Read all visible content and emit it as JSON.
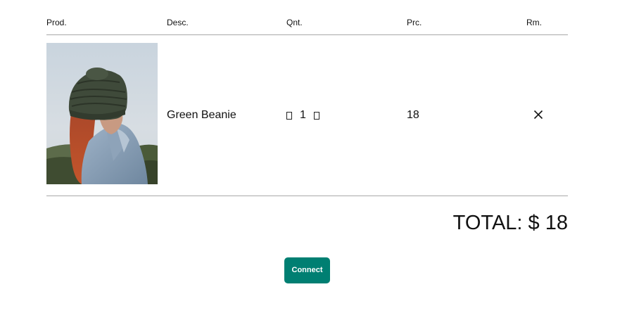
{
  "table": {
    "headers": {
      "product": "Prod.",
      "description": "Desc.",
      "quantity": "Qnt.",
      "price": "Prc.",
      "remove": "Rm."
    },
    "items": [
      {
        "description": "Green Beanie",
        "quantity": "1",
        "price": "18",
        "image_icon": "product-photo-green-beanie",
        "decrement_icon": "decrement-icon",
        "increment_icon": "increment-icon",
        "remove_icon": "close-icon"
      }
    ]
  },
  "summary": {
    "total_label": "TOTAL: $ 18"
  },
  "actions": {
    "connect_label": "Connect"
  },
  "colors": {
    "accent": "#007f72",
    "divider": "#a8a8a8",
    "text": "#111111",
    "background": "#ffffff"
  }
}
